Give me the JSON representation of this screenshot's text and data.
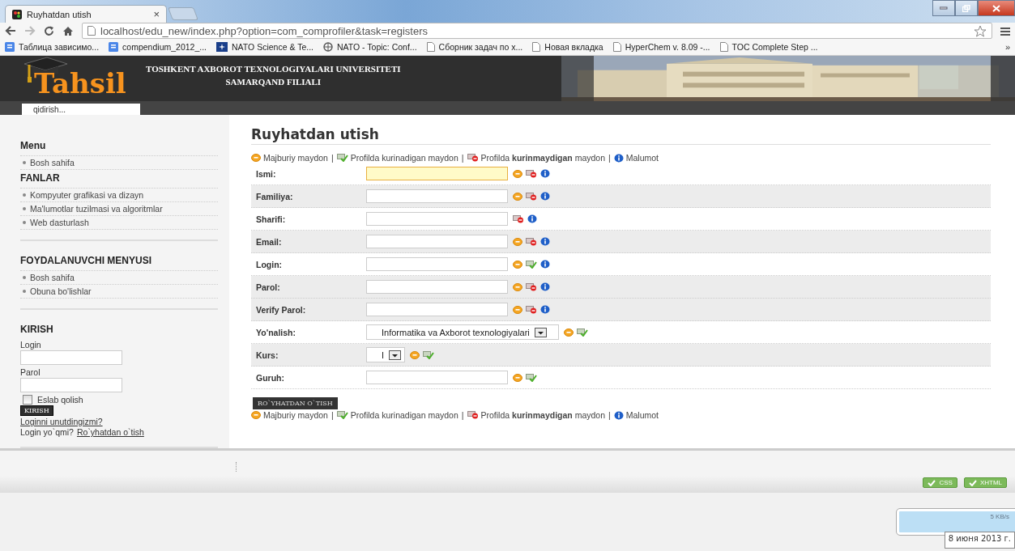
{
  "browser": {
    "tab": {
      "title": "Ruyhatdan utish",
      "close": "×",
      "selected": true
    },
    "address": "localhost/edu_new/index.php?option=com_comprofiler&task=registers",
    "bookmarks": [
      {
        "kind": "docs",
        "label": "Таблица зависимо..."
      },
      {
        "kind": "docs",
        "label": "compendium_2012_..."
      },
      {
        "kind": "nato",
        "label": "NATO Science & Te..."
      },
      {
        "kind": "globe",
        "label": "NATO - Topic: Conf..."
      },
      {
        "kind": "page",
        "label": "Сборник задач по х..."
      },
      {
        "kind": "page",
        "label": "Новая вкладка"
      },
      {
        "kind": "page",
        "label": "HyperChem v. 8.09 -..."
      },
      {
        "kind": "page",
        "label": "TOC Complete Step ..."
      }
    ],
    "more": "»"
  },
  "header": {
    "logo": "Tahsil",
    "university": "TOSHKENT AXBOROT TEXNOLOGIYALARI UNIVERSITETI",
    "branch": "SAMARQAND FILIALI",
    "search": {
      "placeholder": "qidirish..."
    }
  },
  "sidebar": {
    "sections": [
      {
        "menus": [
          {
            "title": "Menu",
            "items": [
              "Bosh sahifa"
            ]
          },
          {
            "title": "FANLAR",
            "items": [
              "Kompyuter grafikasi va dizayn",
              "Ma'lumotlar tuzilmasi va algoritmlar",
              "Web dasturlash"
            ]
          }
        ]
      },
      {
        "menus": [
          {
            "title": "FOYDALANUVCHI MENYUSI",
            "items": [
              "Bosh sahifa",
              "Obuna bo'lishlar"
            ]
          }
        ]
      }
    ],
    "login": {
      "title": "KIRISH",
      "login_label": "Login",
      "password_label": "Parol",
      "remember": {
        "label": "Eslab qolish",
        "checked": false
      },
      "button": "KIRISH",
      "forgot_link": "Loginni unutdingizmi?",
      "register_prompt": "Login yo`qmi?",
      "register_link": "Ro`yhatdan o`tish"
    }
  },
  "form": {
    "title": "Ruyhatdan utish",
    "legend_top": [
      {
        "kind": "required",
        "text": "Majburiy maydon"
      },
      {
        "kind": "visible",
        "text": "Profilda kurinadigan maydon"
      },
      {
        "kind": "hidden",
        "text": "Profilda **kurinmaydigan** maydon"
      },
      {
        "kind": "info",
        "text": "Malumot"
      }
    ],
    "legend_bottom": [
      {
        "kind": "required",
        "text": "Majburiy maydon"
      },
      {
        "kind": "visible",
        "text": "Profilda kurinadigan maydon"
      },
      {
        "kind": "hidden",
        "text": "Profilda **kurinmaydigan** maydon"
      },
      {
        "kind": "info",
        "text": "Malumot"
      }
    ],
    "separator": "|",
    "fields": [
      {
        "label": "Ismi:",
        "kind": "text",
        "focused": true,
        "shaded": false,
        "required": true,
        "shown_in_profile": false,
        "info": true
      },
      {
        "label": "Familiya:",
        "kind": "text",
        "focused": false,
        "shaded": true,
        "required": true,
        "shown_in_profile": false,
        "info": true
      },
      {
        "label": "Sharifi:",
        "kind": "text",
        "focused": false,
        "shaded": false,
        "required": false,
        "shown_in_profile": false,
        "info": true
      },
      {
        "label": "Email:",
        "kind": "text",
        "focused": false,
        "shaded": true,
        "required": true,
        "shown_in_profile": false,
        "info": true
      },
      {
        "label": "Login:",
        "kind": "text",
        "focused": false,
        "shaded": false,
        "required": true,
        "shown_in_profile": true,
        "info": true
      },
      {
        "label": "Parol:",
        "kind": "text",
        "focused": false,
        "shaded": true,
        "required": true,
        "shown_in_profile": false,
        "info": true
      },
      {
        "label": "Verify Parol:",
        "kind": "text",
        "focused": false,
        "shaded": true,
        "required": true,
        "shown_in_profile": false,
        "info": true
      },
      {
        "label": "Yo'nalish:",
        "kind": "select",
        "value": "Informatika va Axborot texnologiyalari",
        "focused": false,
        "shaded": false,
        "required": true,
        "shown_in_profile": true,
        "info": false
      },
      {
        "label": "Kurs:",
        "kind": "select",
        "value": "I",
        "focused": false,
        "shaded": true,
        "required": true,
        "shown_in_profile": true,
        "info": false
      },
      {
        "label": "Guruh:",
        "kind": "text",
        "focused": false,
        "shaded": false,
        "required": true,
        "shown_in_profile": true,
        "info": false
      }
    ],
    "submit": "RO`YHATDAN O`TISH"
  },
  "footer": {
    "badges": [
      "CSS",
      "XHTML"
    ]
  },
  "tray": {
    "network_speed": "5 KB/s",
    "date": "8 июня 2013 г."
  }
}
